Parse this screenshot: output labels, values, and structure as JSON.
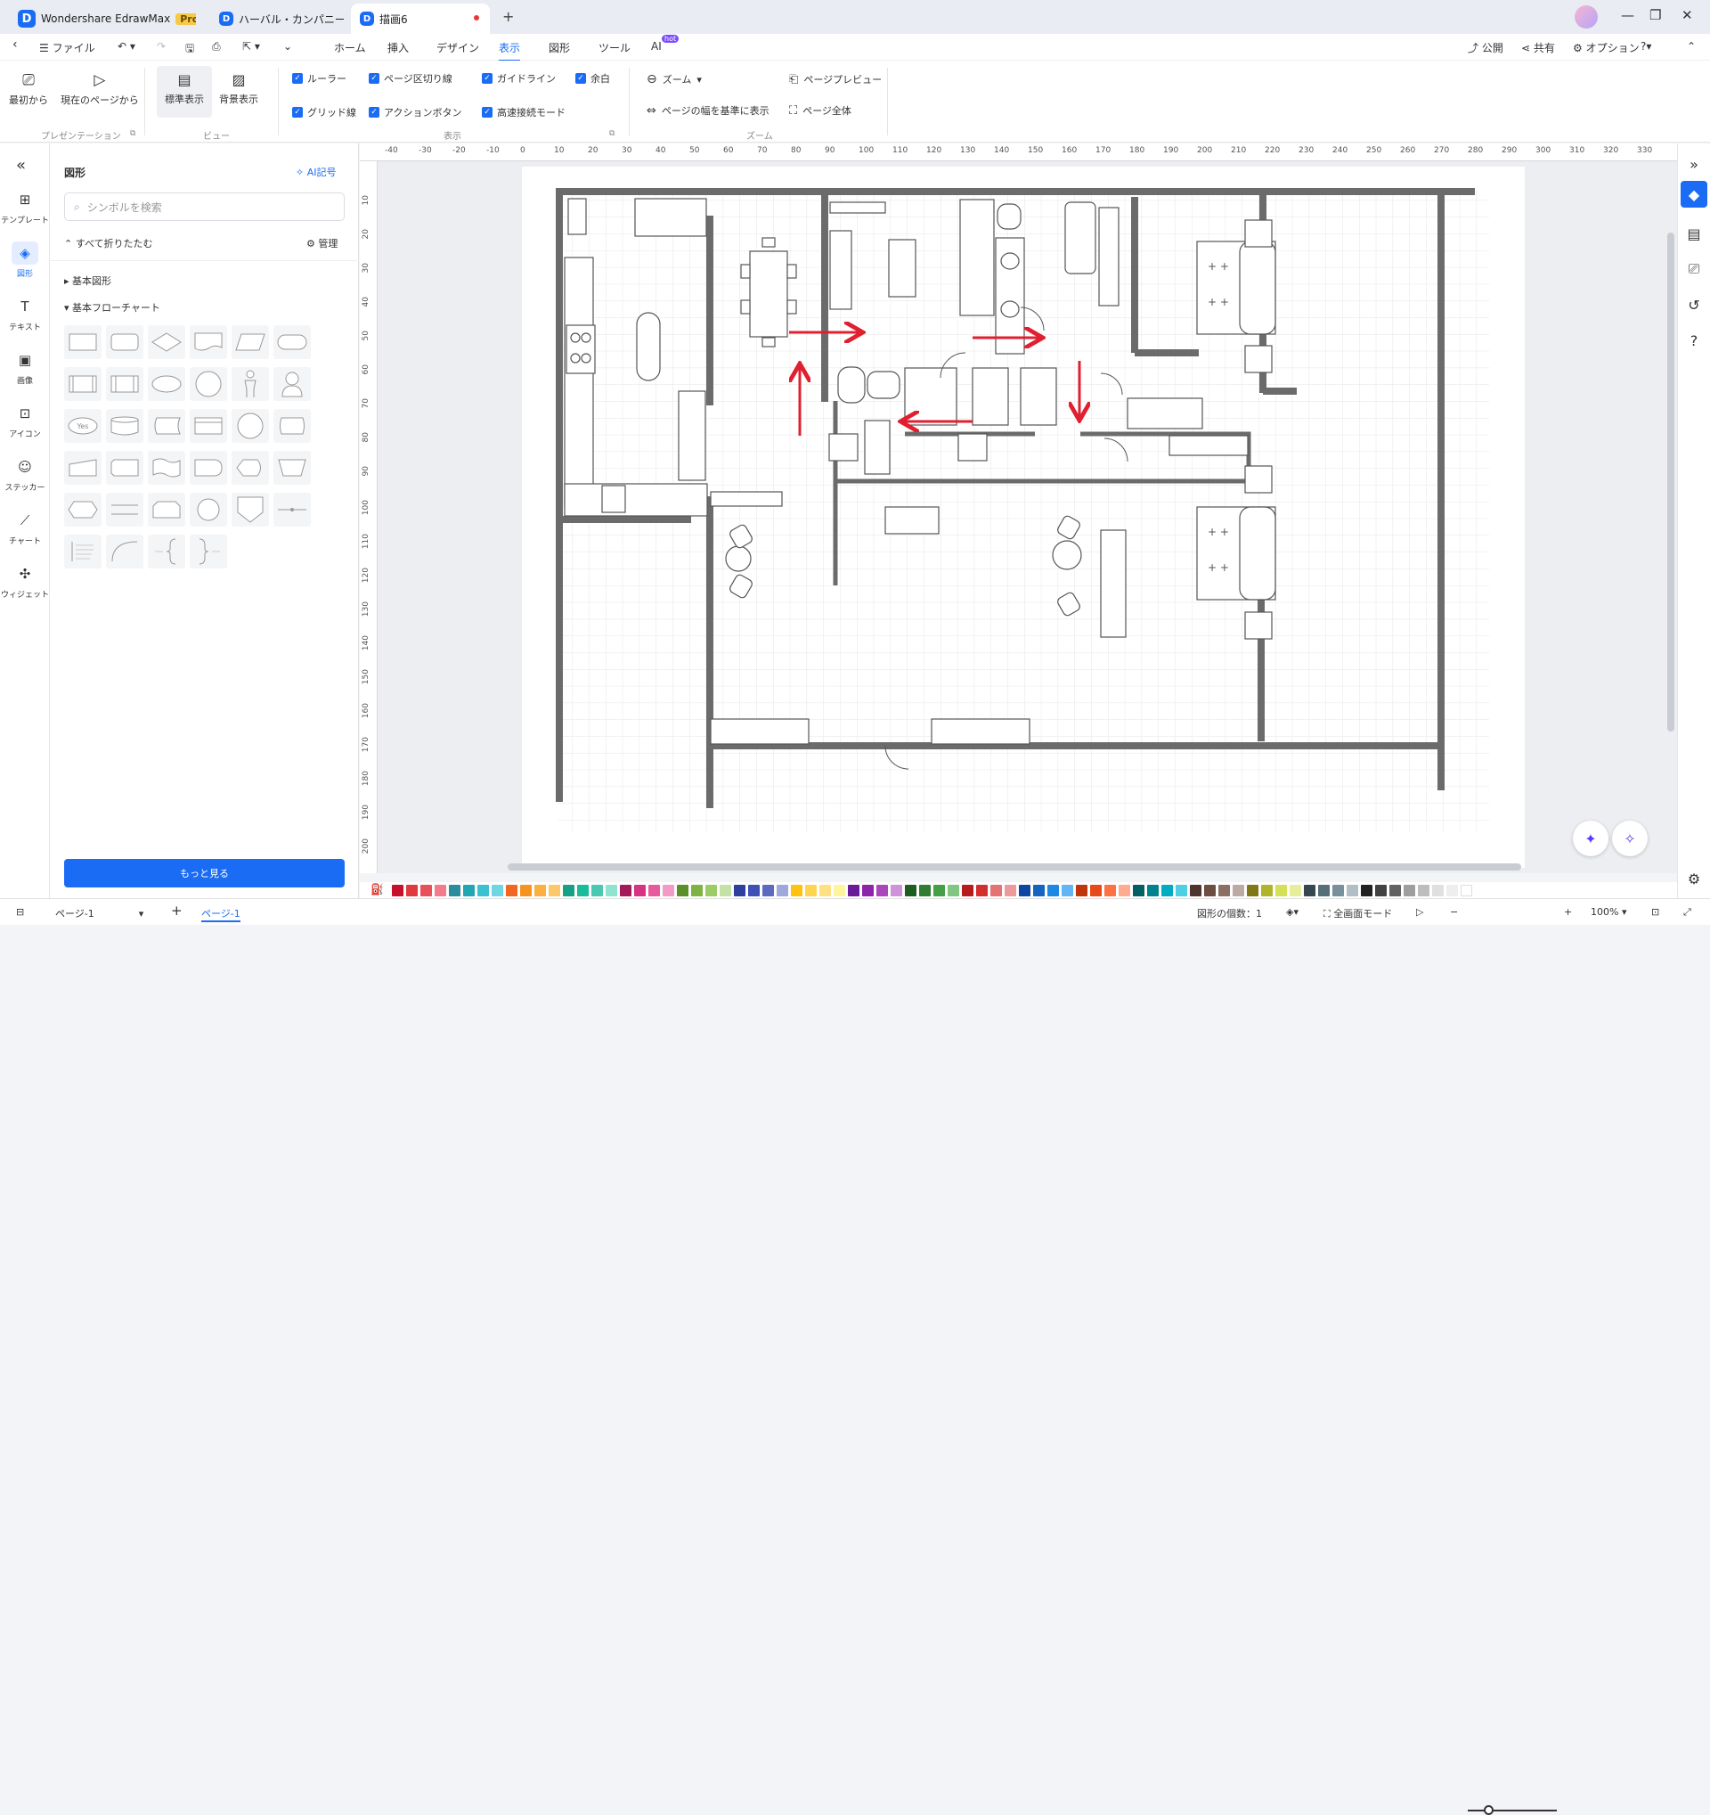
{
  "tabs": [
    {
      "label": "Wondershare EdrawMax",
      "badge": "Pro"
    },
    {
      "label": "ハーバル・カンパニー図_..."
    },
    {
      "label": "描画6"
    }
  ],
  "menubar": {
    "file": "ファイル",
    "items": [
      "ホーム",
      "挿入",
      "デザイン",
      "表示",
      "図形",
      "ツール",
      "AI"
    ],
    "active": "表示",
    "ai_badge": "hot",
    "right": [
      "公開",
      "共有",
      "オプション"
    ]
  },
  "ribbon": {
    "presentation": {
      "from_start": "最初から",
      "from_current": "現在のページから",
      "group": "プレゼンテーション"
    },
    "view": {
      "normal": "標準表示",
      "background": "背景表示",
      "group": "ビュー"
    },
    "display": {
      "items": [
        "ルーラー",
        "ページ区切り線",
        "ガイドライン",
        "余白",
        "グリッド線",
        "アクションボタン",
        "高速接続モード"
      ],
      "group": "表示"
    },
    "zoom": {
      "zoom": "ズーム",
      "fit_width": "ページの幅を基準に表示",
      "preview": "ページプレビュー",
      "whole": "ページ全体",
      "group": "ズーム"
    }
  },
  "leftrail": [
    "テンプレート",
    "図形",
    "テキスト",
    "画像",
    "アイコン",
    "ステッカー",
    "チャート",
    "ウィジェット"
  ],
  "panel": {
    "title": "図形",
    "ai_symbol": "AI記号",
    "search_placeholder": "シンボルを検索",
    "collapse_all": "すべて折りたたむ",
    "manage": "管理",
    "cat1": "基本図形",
    "cat2": "基本フローチャート",
    "yes_label": "Yes",
    "more": "もっと見る"
  },
  "ruler": {
    "top": [
      "-40",
      "-30",
      "-20",
      "-10",
      "0",
      "10",
      "20",
      "30",
      "40",
      "50",
      "60",
      "70",
      "80",
      "90",
      "100",
      "110",
      "120",
      "130",
      "140",
      "150",
      "160",
      "170",
      "180",
      "190",
      "200",
      "210",
      "220",
      "230",
      "240",
      "250",
      "260",
      "270",
      "280",
      "290",
      "300",
      "310",
      "320",
      "330"
    ],
    "left": [
      "10",
      "20",
      "30",
      "40",
      "50",
      "60",
      "70",
      "80",
      "90",
      "100",
      "110",
      "120",
      "130",
      "140",
      "150",
      "160",
      "170",
      "180",
      "190",
      "200"
    ]
  },
  "palette": [
    "#c8102e",
    "#e03a3e",
    "#e8505b",
    "#f47c8a",
    "#2a8c9c",
    "#22a6b3",
    "#3cc1d1",
    "#6fd7e3",
    "#f26522",
    "#f7941d",
    "#fbb040",
    "#fdc86a",
    "#16a085",
    "#1abc9c",
    "#48c9b0",
    "#8ee4d1",
    "#a3195b",
    "#d63384",
    "#e75a9e",
    "#f39ac5",
    "#5a8f29",
    "#7cb342",
    "#9ccc65",
    "#c5e1a5",
    "#2e3f9e",
    "#3f51b5",
    "#5c6bc0",
    "#9fa8da",
    "#ffc20e",
    "#ffd54f",
    "#ffe082",
    "#fff59d",
    "#6a1b9a",
    "#8e24aa",
    "#ab47bc",
    "#ce93d8",
    "#1b5e20",
    "#2e7d32",
    "#43a047",
    "#81c784",
    "#b71c1c",
    "#d32f2f",
    "#e57373",
    "#ef9a9a",
    "#0d47a1",
    "#1565c0",
    "#1e88e5",
    "#64b5f6",
    "#bf360c",
    "#e64a19",
    "#ff7043",
    "#ffab91",
    "#006064",
    "#00838f",
    "#00acc1",
    "#4dd0e1",
    "#4e342e",
    "#6d4c41",
    "#8d6e63",
    "#bcaaa4",
    "#827717",
    "#afb42b",
    "#d4e157",
    "#e6ee9c",
    "#37474f",
    "#546e7a",
    "#78909c",
    "#b0bec5",
    "#212121",
    "#424242",
    "#616161",
    "#9e9e9e",
    "#bdbdbd",
    "#e0e0e0",
    "#eeeeee",
    "#ffffff"
  ],
  "status": {
    "page_select": "ページ-1",
    "page_tab": "ページ-1",
    "shape_count": "図形の個数：1",
    "fullscreen": "全画面モード",
    "zoom": "100%"
  }
}
